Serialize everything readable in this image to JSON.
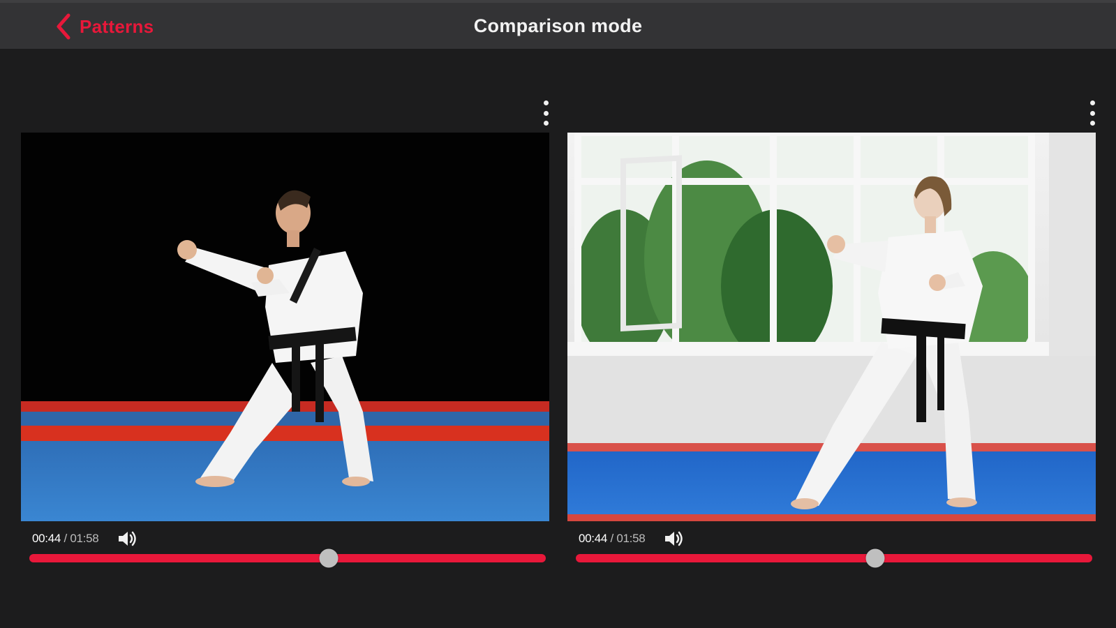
{
  "header": {
    "back_label": "Patterns",
    "back_icon": "chevron-left-icon",
    "title": "Comparison mode"
  },
  "colors": {
    "accent": "#e8183a",
    "background": "#1c1c1d",
    "header_bg": "#333335"
  },
  "videos": [
    {
      "current_time": "00:44",
      "separator": "/",
      "duration": "01:58",
      "progress": 0.58,
      "menu_icon": "more-vertical-icon",
      "volume_icon": "volume-icon"
    },
    {
      "current_time": "00:44",
      "separator": "/",
      "duration": "01:58",
      "progress": 0.58,
      "menu_icon": "more-vertical-icon",
      "volume_icon": "volume-icon"
    }
  ]
}
